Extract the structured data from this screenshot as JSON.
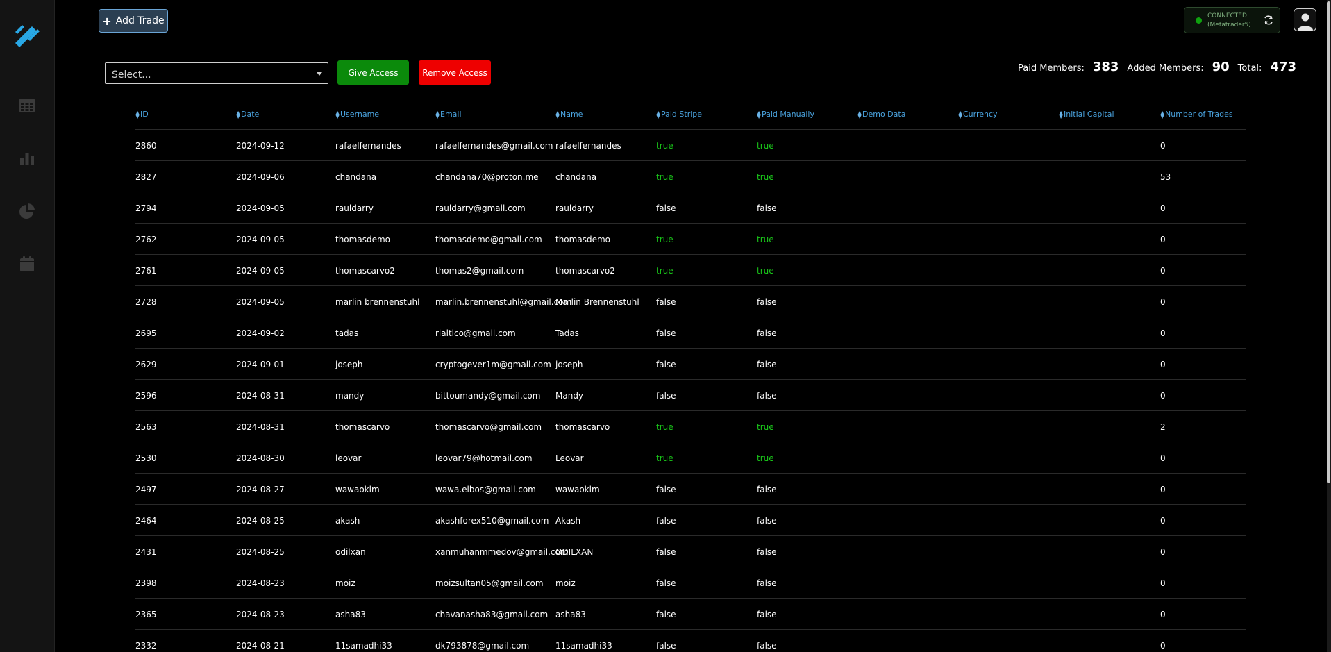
{
  "topbar": {
    "add_trade_label": "Add Trade",
    "connection_status": "CONNECTED",
    "connection_platform": "(Metatrader5)"
  },
  "controls": {
    "select_placeholder": "Select...",
    "give_access_label": "Give Access",
    "remove_access_label": "Remove Access"
  },
  "stats": {
    "paid_label": "Paid Members:",
    "paid_value": "383",
    "added_label": "Added Members:",
    "added_value": "90",
    "total_label": "Total:",
    "total_value": "473"
  },
  "table": {
    "columns": [
      "ID",
      "Date",
      "Username",
      "Email",
      "Name",
      "Paid Stripe",
      "Paid Manually",
      "Demo Data",
      "Currency",
      "Initial Capital",
      "Number of Trades"
    ],
    "rows": [
      {
        "id": "2860",
        "date": "2024-09-12",
        "username": "rafaelfernandes",
        "email": "rafaelfernandes@gmail.com",
        "name": "rafaelfernandes",
        "paid_stripe": "true",
        "paid_manually": "true",
        "trades": "0"
      },
      {
        "id": "2827",
        "date": "2024-09-06",
        "username": "chandana",
        "email": "chandana70@proton.me",
        "name": "chandana",
        "paid_stripe": "true",
        "paid_manually": "true",
        "trades": "53"
      },
      {
        "id": "2794",
        "date": "2024-09-05",
        "username": "rauldarry",
        "email": "rauldarry@gmail.com",
        "name": "rauldarry",
        "paid_stripe": "false",
        "paid_manually": "false",
        "trades": "0"
      },
      {
        "id": "2762",
        "date": "2024-09-05",
        "username": "thomasdemo",
        "email": "thomasdemo@gmail.com",
        "name": "thomasdemo",
        "paid_stripe": "true",
        "paid_manually": "true",
        "trades": "0"
      },
      {
        "id": "2761",
        "date": "2024-09-05",
        "username": "thomascarvo2",
        "email": "thomas2@gmail.com",
        "name": "thomascarvo2",
        "paid_stripe": "true",
        "paid_manually": "true",
        "trades": "0"
      },
      {
        "id": "2728",
        "date": "2024-09-05",
        "username": "marlin brennenstuhl",
        "email": "marlin.brennenstuhl@gmail.com",
        "name": "Marlin Brennenstuhl",
        "paid_stripe": "false",
        "paid_manually": "false",
        "trades": "0"
      },
      {
        "id": "2695",
        "date": "2024-09-02",
        "username": "tadas",
        "email": "rialtico@gmail.com",
        "name": "Tadas",
        "paid_stripe": "false",
        "paid_manually": "false",
        "trades": "0"
      },
      {
        "id": "2629",
        "date": "2024-09-01",
        "username": "joseph",
        "email": "cryptogever1m@gmail.com",
        "name": "joseph",
        "paid_stripe": "false",
        "paid_manually": "false",
        "trades": "0"
      },
      {
        "id": "2596",
        "date": "2024-08-31",
        "username": "mandy",
        "email": "bittoumandy@gmail.com",
        "name": "Mandy",
        "paid_stripe": "false",
        "paid_manually": "false",
        "trades": "0"
      },
      {
        "id": "2563",
        "date": "2024-08-31",
        "username": "thomascarvo",
        "email": "thomascarvo@gmail.com",
        "name": "thomascarvo",
        "paid_stripe": "true",
        "paid_manually": "true",
        "trades": "2"
      },
      {
        "id": "2530",
        "date": "2024-08-30",
        "username": "leovar",
        "email": "leovar79@hotmail.com",
        "name": "Leovar",
        "paid_stripe": "true",
        "paid_manually": "true",
        "trades": "0"
      },
      {
        "id": "2497",
        "date": "2024-08-27",
        "username": "wawaoklm",
        "email": "wawa.elbos@gmail.com",
        "name": "wawaoklm",
        "paid_stripe": "false",
        "paid_manually": "false",
        "trades": "0"
      },
      {
        "id": "2464",
        "date": "2024-08-25",
        "username": "akash",
        "email": "akashforex510@gmail.com",
        "name": "Akash",
        "paid_stripe": "false",
        "paid_manually": "false",
        "trades": "0"
      },
      {
        "id": "2431",
        "date": "2024-08-25",
        "username": "odilxan",
        "email": "xanmuhanmmedov@gmail.com",
        "name": "ODILXAN",
        "paid_stripe": "false",
        "paid_manually": "false",
        "trades": "0"
      },
      {
        "id": "2398",
        "date": "2024-08-23",
        "username": "moiz",
        "email": "moizsultan05@gmail.com",
        "name": "moiz",
        "paid_stripe": "false",
        "paid_manually": "false",
        "trades": "0"
      },
      {
        "id": "2365",
        "date": "2024-08-23",
        "username": "asha83",
        "email": "chavanasha83@gmail.com",
        "name": "asha83",
        "paid_stripe": "false",
        "paid_manually": "false",
        "trades": "0"
      },
      {
        "id": "2332",
        "date": "2024-08-21",
        "username": "11samadhi33",
        "email": "dk793878@gmail.com",
        "name": "11samadhi33",
        "paid_stripe": "false",
        "paid_manually": "false",
        "trades": "0"
      }
    ]
  },
  "icons": {
    "logo": "logo-icon",
    "nav": [
      "calendar-grid-icon",
      "bar-chart-icon",
      "pie-chart-icon",
      "calendar-icon"
    ],
    "refresh": "refresh-icon",
    "avatar": "user-avatar-icon"
  },
  "colors": {
    "accent": "#4aa3df",
    "true": "#19c519",
    "give": "#0b8a0b",
    "remove": "#e00000"
  }
}
